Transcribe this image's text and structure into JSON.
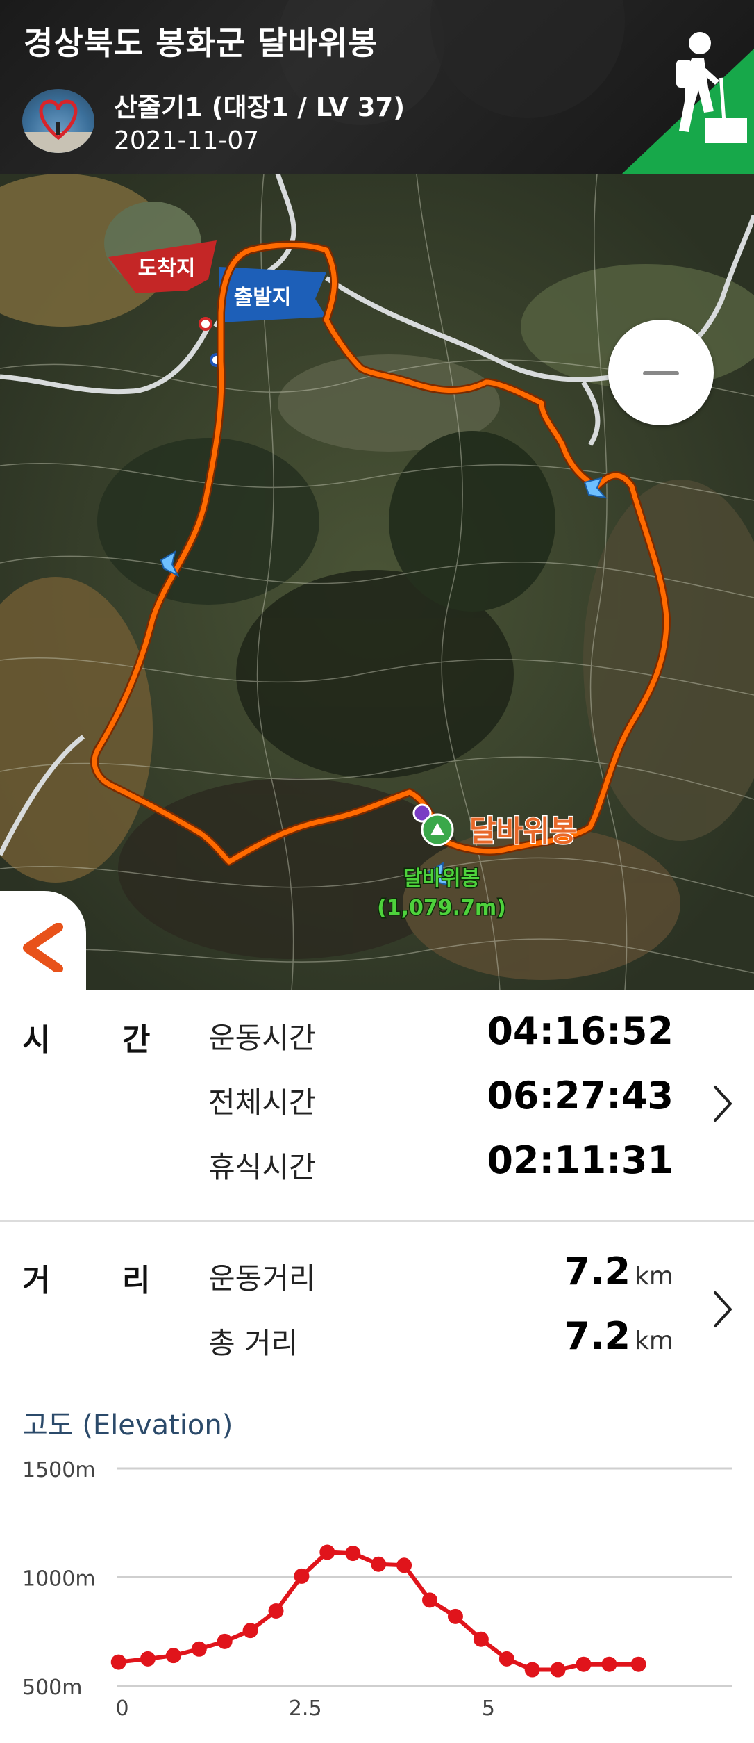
{
  "header": {
    "title": "경상북도 봉화군 달바위봉",
    "user_name": "산줄기1 (대장1 / LV 37)",
    "date": "2021-11-07"
  },
  "map": {
    "arrival_label": "도착지",
    "departure_label": "출발지",
    "peak_label": "달바위봉",
    "peak_marker_name": "달바위봉",
    "peak_marker_elevation": "(1,079.7m)"
  },
  "time": {
    "section_label_1": "시",
    "section_label_2": "간",
    "rows": [
      {
        "label": "운동시간",
        "value": "04:16:52"
      },
      {
        "label": "전체시간",
        "value": "06:27:43"
      },
      {
        "label": "휴식시간",
        "value": "02:11:31"
      }
    ]
  },
  "distance": {
    "section_label_1": "거",
    "section_label_2": "리",
    "rows": [
      {
        "label": "운동거리",
        "value": "7.2",
        "unit": "km"
      },
      {
        "label": "총 거리",
        "value": "7.2",
        "unit": "km"
      }
    ]
  },
  "elevation": {
    "title": "고도 (Elevation)"
  },
  "colors": {
    "route": "#ff6a00",
    "arrival_flag": "#c42626",
    "departure_flag": "#1d5fb8",
    "badge": "#17a84a",
    "chart_line": "#e0141b",
    "grid": "#cfcfcf"
  },
  "chart_data": {
    "type": "line",
    "title": "고도 (Elevation)",
    "xlabel": "",
    "ylabel": "",
    "xlim": [
      0,
      7.2
    ],
    "ylim": [
      500,
      1500
    ],
    "y_ticks": [
      "500m",
      "1000m",
      "1500m"
    ],
    "x_ticks": [
      "0",
      "2.5",
      "5"
    ],
    "series": [
      {
        "x": [
          -0.05,
          0.35,
          0.7,
          1.05,
          1.4,
          1.75,
          2.1,
          2.45,
          2.8,
          3.15,
          3.5,
          3.85,
          4.2,
          4.55,
          4.9,
          5.25,
          5.6,
          5.95,
          6.3,
          6.65,
          7.05
        ],
        "values": [
          610,
          625,
          640,
          670,
          705,
          755,
          845,
          1005,
          1115,
          1110,
          1060,
          1055,
          895,
          820,
          715,
          625,
          575,
          575,
          600,
          600,
          600
        ]
      }
    ]
  }
}
